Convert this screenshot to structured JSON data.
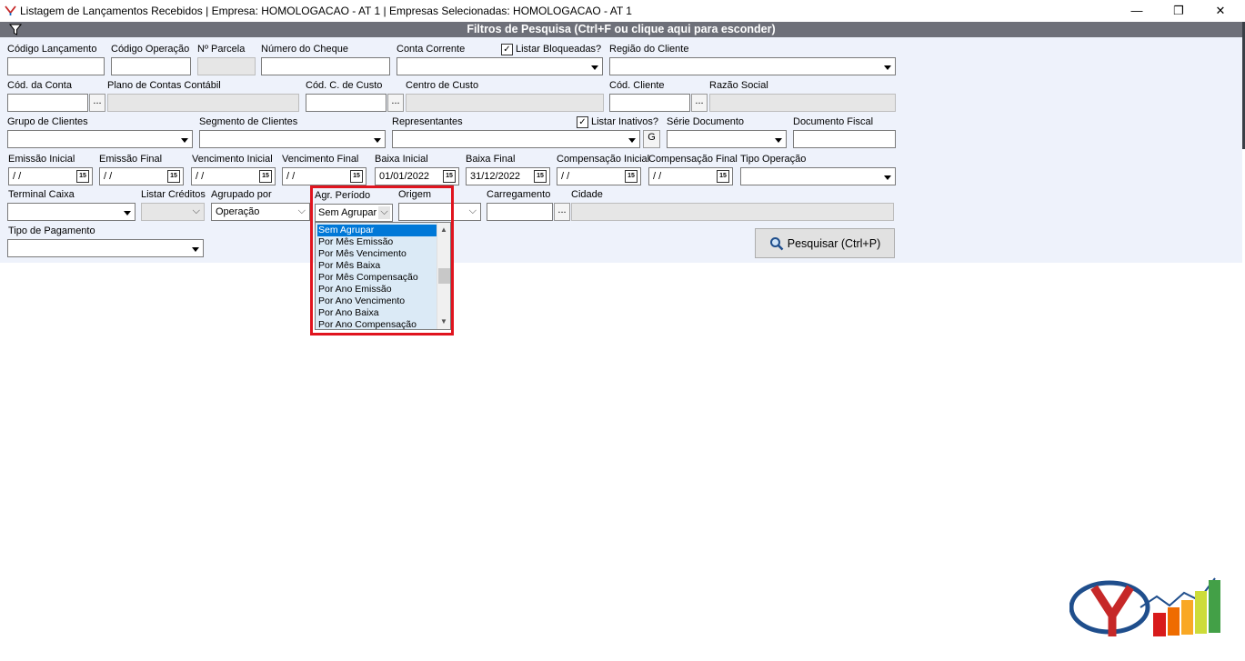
{
  "window": {
    "title": "Listagem de Lançamentos Recebidos | Empresa: HOMOLOGACAO - AT 1 | Empresas Selecionadas: HOMOLOGACAO - AT 1",
    "minimize": "—",
    "restore": "❐",
    "close": "✕"
  },
  "panel": {
    "header": "Filtros de Pesquisa (Ctrl+F ou clique aqui para esconder)"
  },
  "labels": {
    "codigo_lancamento": "Código Lançamento",
    "codigo_operacao": "Código Operação",
    "n_parcela": "Nº Parcela",
    "numero_cheque": "Número do Cheque",
    "conta_corrente": "Conta Corrente",
    "listar_bloqueadas": "Listar Bloqueadas?",
    "regiao_cliente": "Região do Cliente",
    "cod_conta": "Cód. da Conta",
    "plano_contas": "Plano de Contas Contábil",
    "cod_centro_custo": "Cód. C. de Custo",
    "centro_custo": "Centro de Custo",
    "cod_cliente": "Cód. Cliente",
    "razao_social": "Razão Social",
    "grupo_clientes": "Grupo de Clientes",
    "segmento_clientes": "Segmento de Clientes",
    "representantes": "Representantes",
    "listar_inativos": "Listar Inativos?",
    "serie_documento": "Série Documento",
    "documento_fiscal": "Documento Fiscal",
    "emissao_inicial": "Emissão Inicial",
    "emissao_final": "Emissão Final",
    "vencimento_inicial": "Vencimento Inicial",
    "vencimento_final": "Vencimento Final",
    "baixa_inicial": "Baixa Inicial",
    "baixa_final": "Baixa Final",
    "compensacao_inicial": "Compensação Inicial",
    "compensacao_final": "Compensação Final",
    "tipo_operacao": "Tipo Operação",
    "terminal_caixa": "Terminal Caixa",
    "listar_creditos": "Listar Créditos",
    "agrupado_por": "Agrupado por",
    "agr_periodo": "Agr. Período",
    "origem": "Origem",
    "carregamento": "Carregamento",
    "cidade": "Cidade",
    "tipo_pagamento": "Tipo de Pagamento"
  },
  "values": {
    "date_empty": " / /",
    "baixa_inicial": "01/01/2022",
    "baixa_final": "31/12/2022",
    "agrupado_por": "Operação",
    "agr_periodo": "Sem Agrupar",
    "ellipsis": "...",
    "g_button": "G",
    "cal_icon": "15",
    "check": "✓"
  },
  "listar_bloqueadas_checked": true,
  "listar_inativos_checked": true,
  "period_options": [
    "Sem Agrupar",
    "Por Mês Emissão",
    "Por Mês Vencimento",
    "Por Mês Baixa",
    "Por Mês Compensação",
    "Por Ano Emissão",
    "Por Ano Vencimento",
    "Por Ano Baixa",
    "Por Ano Compensação"
  ],
  "period_selected": "Sem Agrupar",
  "search_button": "Pesquisar (Ctrl+P)",
  "colors": {
    "header_bg": "#6e7079",
    "panel_bg": "#eef2fb",
    "highlight": "#e0141e",
    "selection": "#0078d7",
    "list_bg": "#dbeaf6"
  }
}
